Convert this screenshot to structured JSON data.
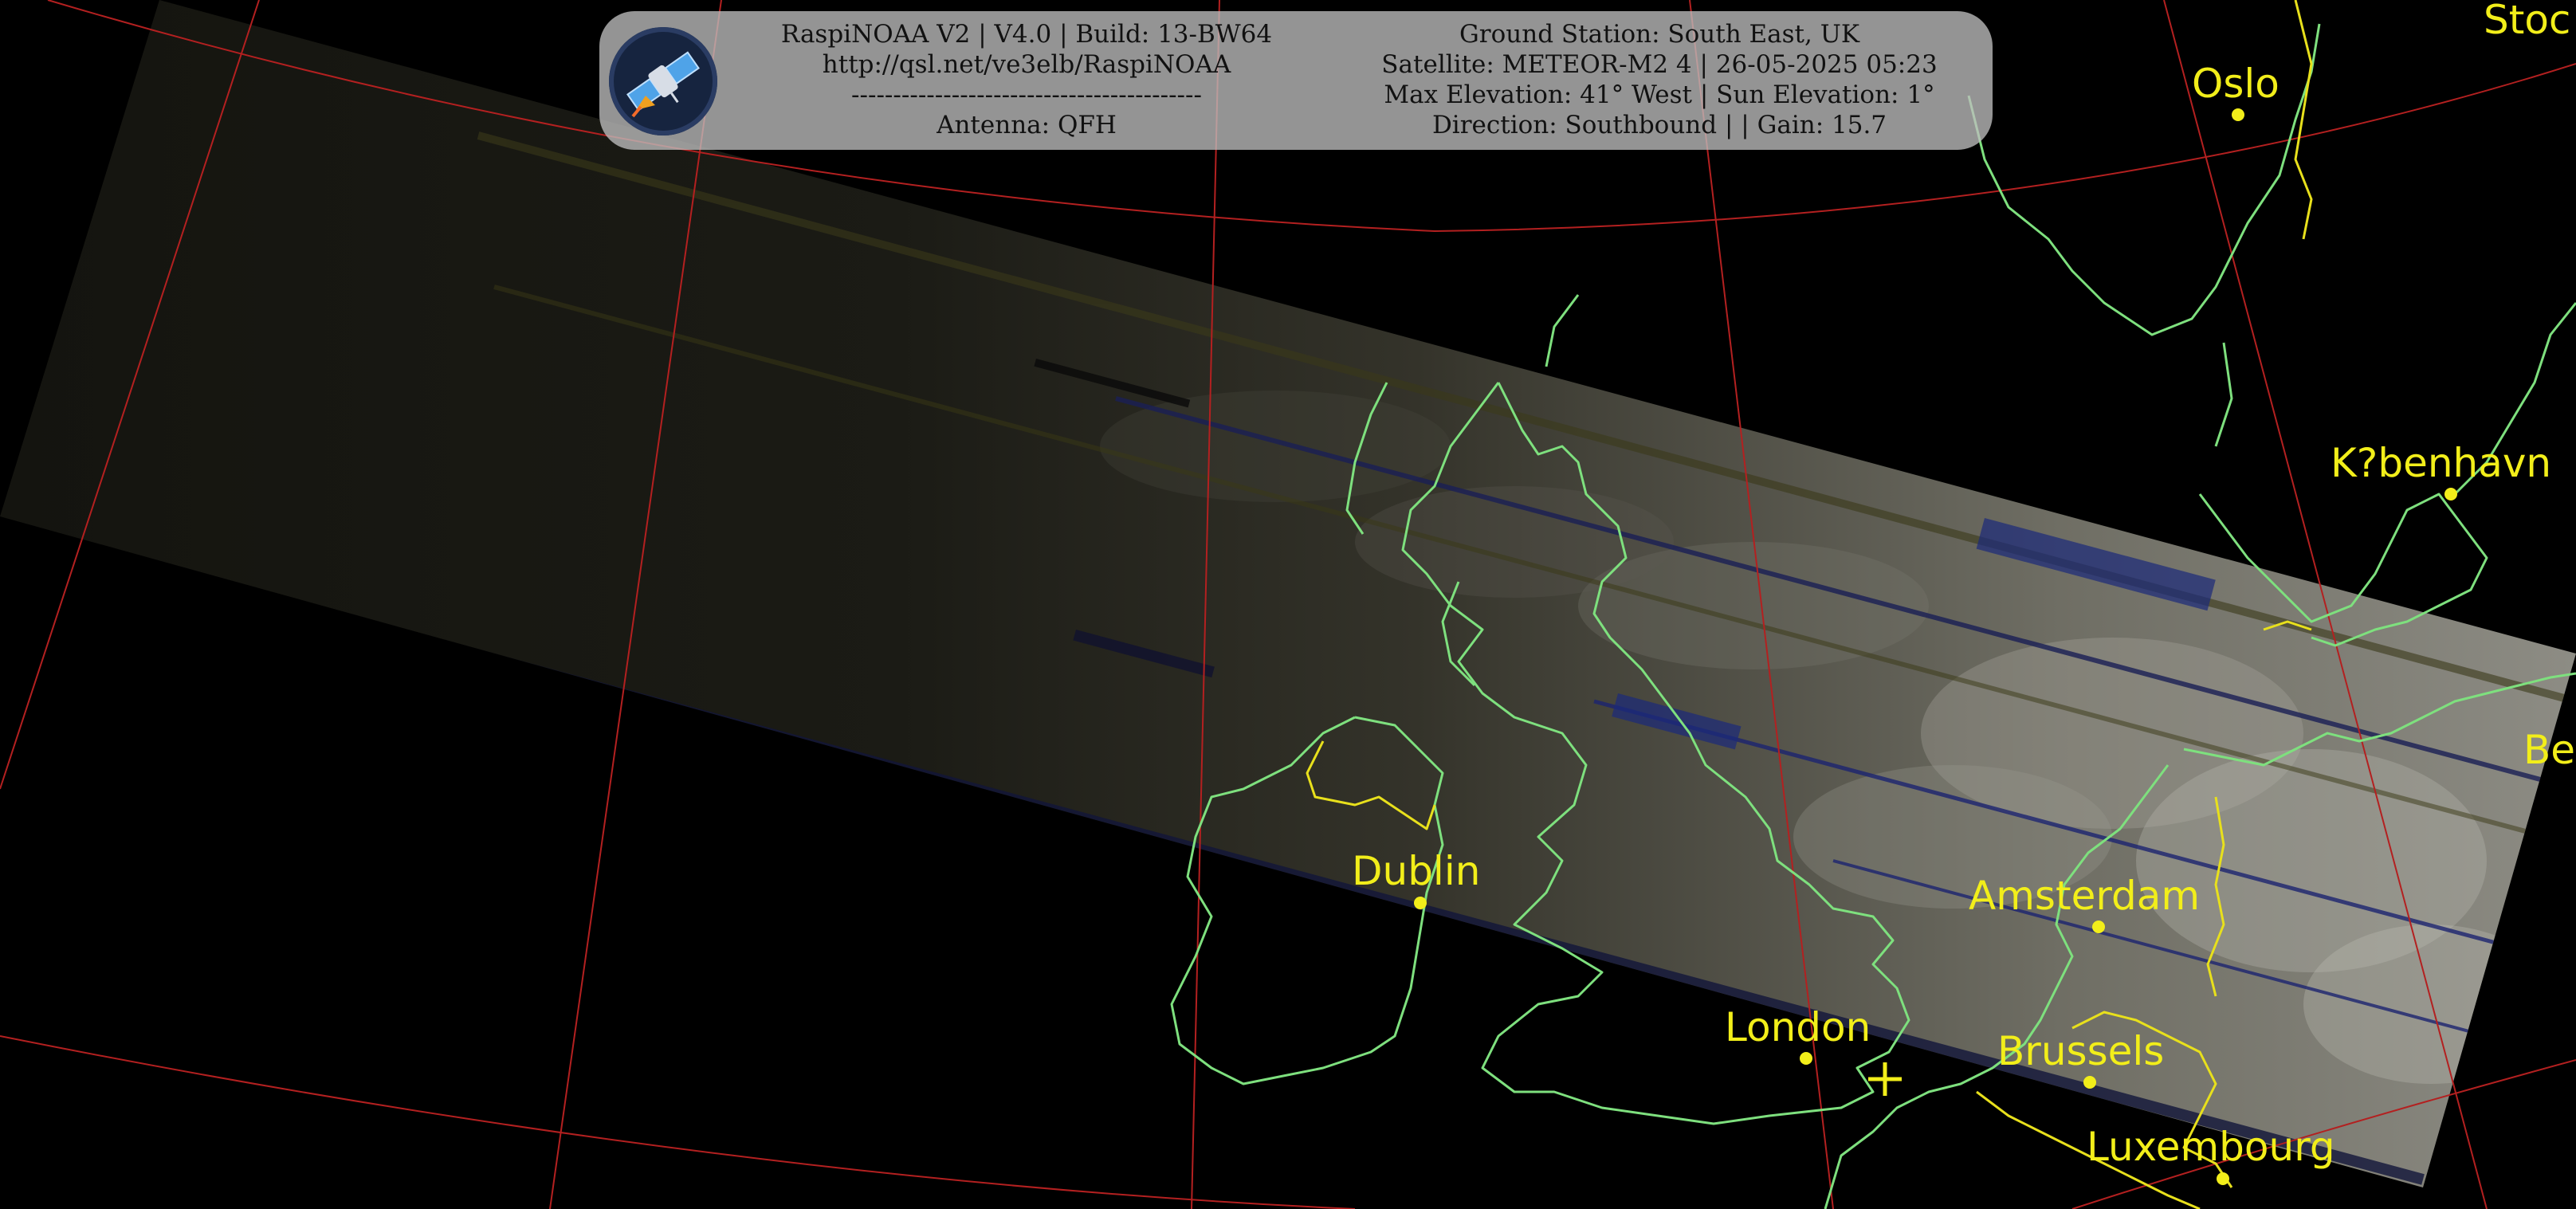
{
  "header": {
    "left_lines": [
      "RaspiNOAA V2 | V4.0 | Build: 13-BW64",
      "http://qsl.net/ve3elb/RaspiNOAA",
      "------------------------------------------",
      "Antenna: QFH"
    ],
    "right_lines": [
      "Ground Station: South East, UK",
      "Satellite: METEOR-M2 4 | 26-05-2025 05:23",
      "Max Elevation: 41° West | Sun Elevation: 1°",
      "Direction: Southbound | | Gain: 15.7"
    ],
    "logo_icon": "satellite-logo-icon"
  },
  "map": {
    "cities": [
      {
        "name": "Oslo"
      },
      {
        "name": "K?benhavn"
      },
      {
        "name": "Dublin"
      },
      {
        "name": "Amsterdam"
      },
      {
        "name": "London"
      },
      {
        "name": "Brussels"
      },
      {
        "name": "Luxembourg"
      },
      {
        "name": "Stoc"
      },
      {
        "name": "Be"
      }
    ],
    "colors": {
      "background": "#000000",
      "graticule": "#b32020",
      "coastline": "#7ee07e",
      "border": "#e8e01c",
      "city": "#f2ee1a",
      "panel": "#bebebe"
    },
    "icons": {
      "ground_station": "ground-station-cross-icon"
    }
  }
}
